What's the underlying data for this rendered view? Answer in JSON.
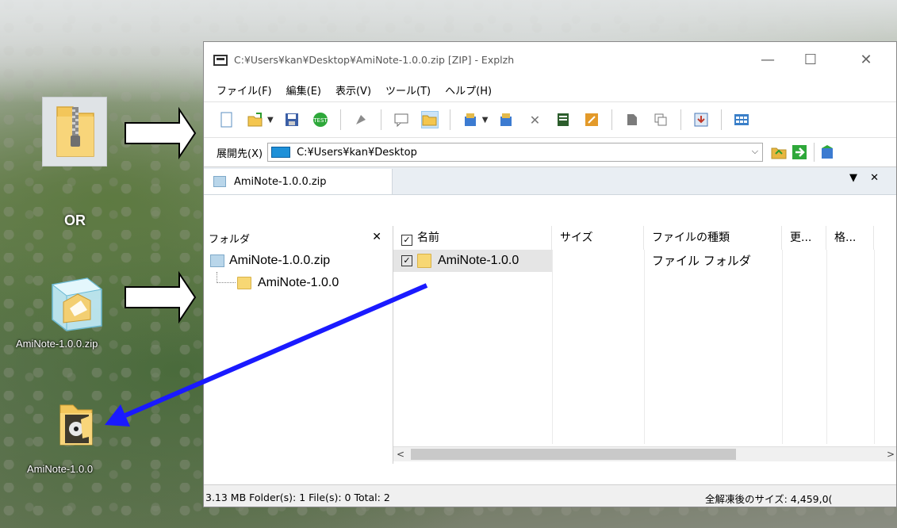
{
  "desktop": {
    "or_label": "OR",
    "icons": [
      {
        "label": "",
        "icon": "zip-folder-icon"
      },
      {
        "label": "AmiNote-1.0.0.zip",
        "icon": "archive-cube-icon"
      },
      {
        "label": "AmiNote-1.0.0",
        "icon": "extracted-folder-icon"
      }
    ],
    "arrow_color": "#1a1aff"
  },
  "window": {
    "title": "C:¥Users¥kan¥Desktop¥AmiNote-1.0.0.zip [ZIP] - Explzh",
    "controls": {
      "minimize": "—",
      "maximize": "☐",
      "close": "✕"
    },
    "menu": [
      "ファイル(F)",
      "編集(E)",
      "表示(V)",
      "ツール(T)",
      "ヘルプ(H)"
    ],
    "toolbar_icons": [
      "new-icon",
      "open-icon",
      "save-icon",
      "test-icon",
      "extract-icon",
      "comment-icon",
      "folder-view-icon",
      "add-icon",
      "extract-to-icon",
      "delete-icon",
      "properties-icon",
      "edit-icon",
      "view-icon",
      "window-icon",
      "download-icon",
      "grid-icon"
    ],
    "address": {
      "label": "展開先(X)",
      "value": "C:¥Users¥kan¥Desktop"
    },
    "tab": {
      "label": "AmiNote-1.0.0.zip",
      "controls": "▼ ✕"
    },
    "tree": {
      "header": "フォルダ",
      "close": "✕",
      "root": "AmiNote-1.0.0.zip",
      "child": "AmiNote-1.0.0"
    },
    "list": {
      "columns": [
        "名前",
        "サイズ",
        "ファイルの種類",
        "更...",
        "格..."
      ],
      "rows": [
        {
          "name": "AmiNote-1.0.0",
          "size": "",
          "type": "ファイル フォルダ",
          "checked": true
        }
      ]
    },
    "scroll": {
      "left": "<",
      "right": ">"
    },
    "status": {
      "left": "3.13 MB  Folder(s): 1  File(s): 0  Total: 2",
      "right": "全解凍後のサイズ: 4,459,0("
    }
  }
}
